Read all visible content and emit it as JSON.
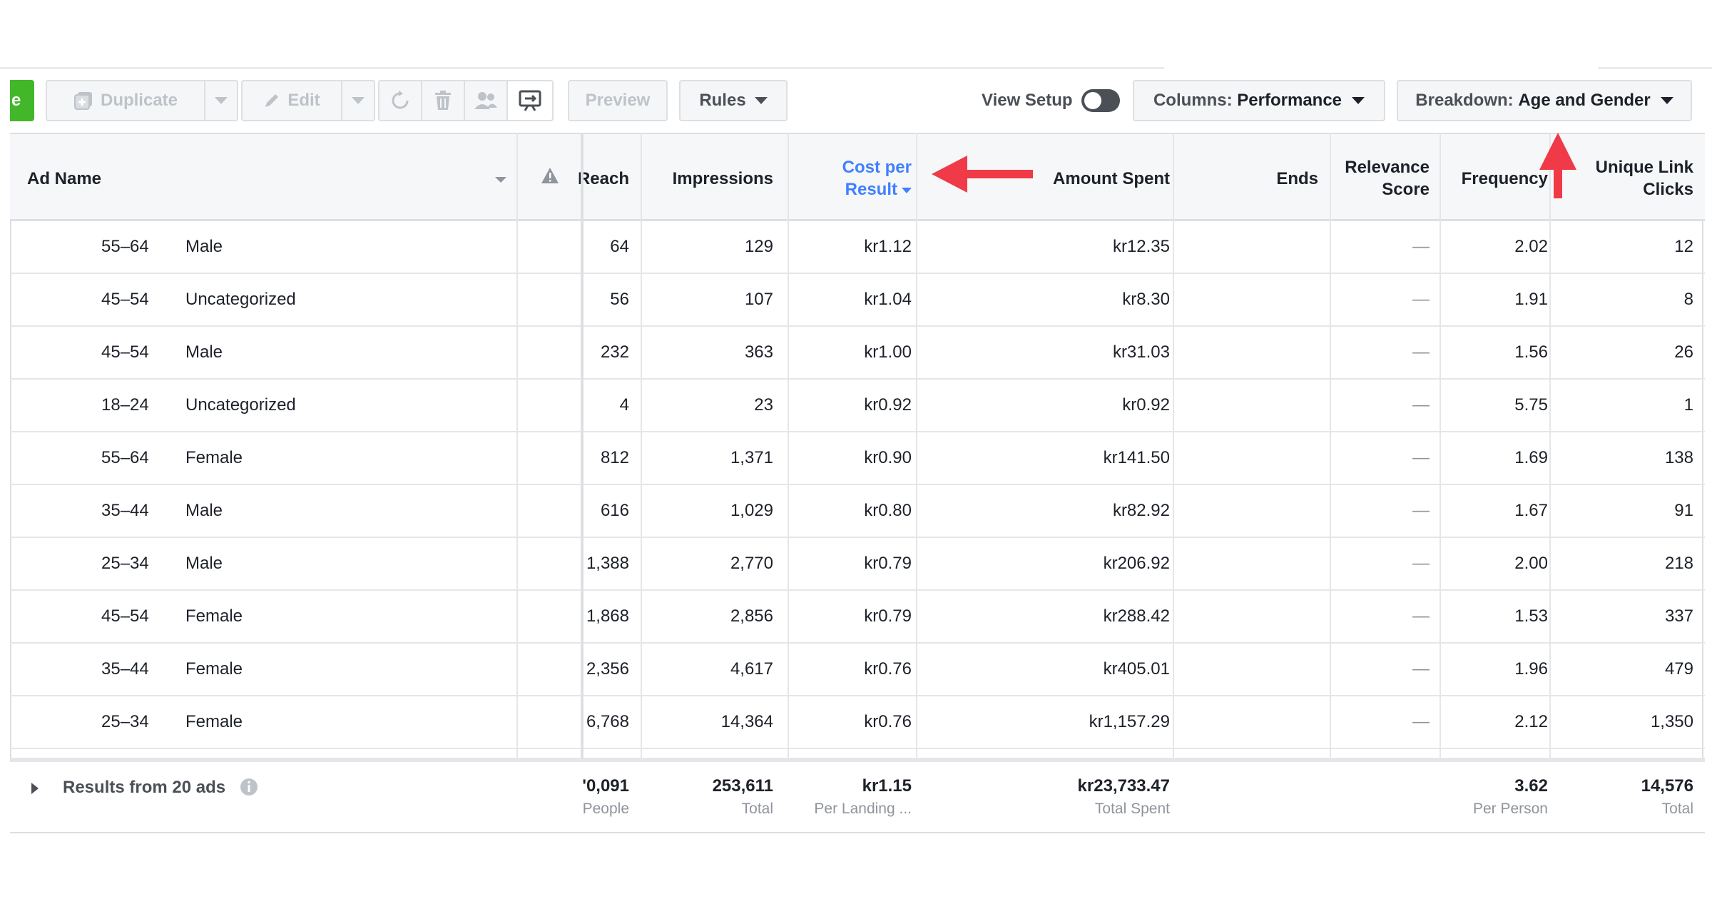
{
  "toolbar": {
    "create_label": "e",
    "duplicate_label": "Duplicate",
    "edit_label": "Edit",
    "preview_label": "Preview",
    "rules_label": "Rules",
    "view_setup_label": "View Setup",
    "columns_prefix": "Columns:",
    "columns_value": "Performance",
    "breakdown_prefix": "Breakdown:",
    "breakdown_value": "Age and Gender"
  },
  "table": {
    "headers": {
      "ad_name": "Ad Name",
      "reach": "Reach",
      "impressions": "Impressions",
      "cost_per_result_1": "Cost per",
      "cost_per_result_2": "Result",
      "amount_spent": "Amount Spent",
      "ends": "Ends",
      "relevance_1": "Relevance",
      "relevance_2": "Score",
      "frequency": "Frequency",
      "unique_clicks_1": "Unique Link",
      "unique_clicks_2": "Clicks"
    },
    "rows": [
      {
        "age": "55–64",
        "gender": "Male",
        "reach": "64",
        "impressions": "129",
        "cpr": "kr1.12",
        "spent": "kr12.35",
        "relevance": "—",
        "frequency": "2.02",
        "clicks": "12"
      },
      {
        "age": "45–54",
        "gender": "Uncategorized",
        "reach": "56",
        "impressions": "107",
        "cpr": "kr1.04",
        "spent": "kr8.30",
        "relevance": "—",
        "frequency": "1.91",
        "clicks": "8"
      },
      {
        "age": "45–54",
        "gender": "Male",
        "reach": "232",
        "impressions": "363",
        "cpr": "kr1.00",
        "spent": "kr31.03",
        "relevance": "—",
        "frequency": "1.56",
        "clicks": "26"
      },
      {
        "age": "18–24",
        "gender": "Uncategorized",
        "reach": "4",
        "impressions": "23",
        "cpr": "kr0.92",
        "spent": "kr0.92",
        "relevance": "—",
        "frequency": "5.75",
        "clicks": "1"
      },
      {
        "age": "55–64",
        "gender": "Female",
        "reach": "812",
        "impressions": "1,371",
        "cpr": "kr0.90",
        "spent": "kr141.50",
        "relevance": "—",
        "frequency": "1.69",
        "clicks": "138"
      },
      {
        "age": "35–44",
        "gender": "Male",
        "reach": "616",
        "impressions": "1,029",
        "cpr": "kr0.80",
        "spent": "kr82.92",
        "relevance": "—",
        "frequency": "1.67",
        "clicks": "91"
      },
      {
        "age": "25–34",
        "gender": "Male",
        "reach": "1,388",
        "impressions": "2,770",
        "cpr": "kr0.79",
        "spent": "kr206.92",
        "relevance": "—",
        "frequency": "2.00",
        "clicks": "218"
      },
      {
        "age": "45–54",
        "gender": "Female",
        "reach": "1,868",
        "impressions": "2,856",
        "cpr": "kr0.79",
        "spent": "kr288.42",
        "relevance": "—",
        "frequency": "1.53",
        "clicks": "337"
      },
      {
        "age": "35–44",
        "gender": "Female",
        "reach": "2,356",
        "impressions": "4,617",
        "cpr": "kr0.76",
        "spent": "kr405.01",
        "relevance": "—",
        "frequency": "1.96",
        "clicks": "479"
      },
      {
        "age": "25–34",
        "gender": "Female",
        "reach": "6,768",
        "impressions": "14,364",
        "cpr": "kr0.76",
        "spent": "kr1,157.29",
        "relevance": "—",
        "frequency": "2.12",
        "clicks": "1,350"
      }
    ],
    "summary": {
      "label": "Results from 20 ads",
      "reach": "'0,091",
      "reach_sub": "People",
      "impressions": "253,611",
      "impressions_sub": "Total",
      "cpr": "kr1.15",
      "cpr_sub": "Per Landing ...",
      "spent": "kr23,733.47",
      "spent_sub": "Total Spent",
      "frequency": "3.62",
      "frequency_sub": "Per Person",
      "clicks": "14,576",
      "clicks_sub": "Total"
    }
  },
  "colors": {
    "accent_blue": "#4080ff",
    "create_green": "#42b72a",
    "annotation_red": "#f03a47"
  }
}
